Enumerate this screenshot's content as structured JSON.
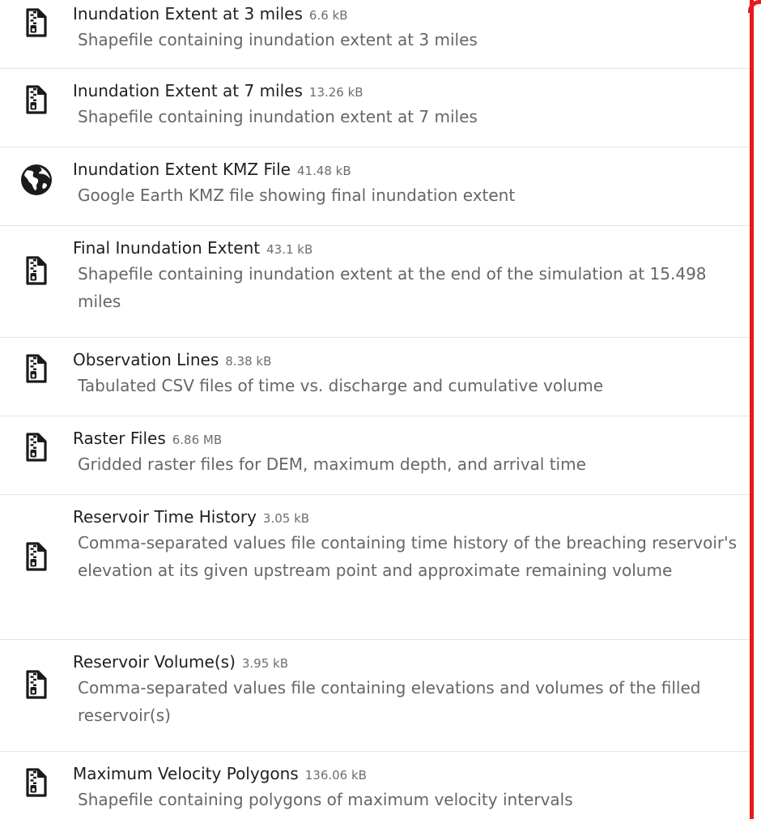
{
  "files": [
    {
      "title": "Inundation Extent at 3 miles",
      "size": "6.6 kB",
      "description": "Shapefile containing inundation extent at 3 miles",
      "icon": "zip-file-icon"
    },
    {
      "title": "Inundation Extent at 7 miles",
      "size": "13.26 kB",
      "description": "Shapefile containing inundation extent at 7 miles",
      "icon": "zip-file-icon"
    },
    {
      "title": "Inundation Extent KMZ File",
      "size": "41.48 kB",
      "description": "Google Earth KMZ file showing final inundation extent",
      "icon": "globe-icon"
    },
    {
      "title": "Final Inundation Extent",
      "size": "43.1 kB",
      "description": "Shapefile containing inundation extent at the end of the simulation at 15.498 miles",
      "icon": "zip-file-icon"
    },
    {
      "title": "Observation Lines",
      "size": "8.38 kB",
      "description": "Tabulated CSV files of time vs. discharge and cumulative volume",
      "icon": "zip-file-icon"
    },
    {
      "title": "Raster Files",
      "size": "6.86 MB",
      "description": "Gridded raster files for DEM, maximum depth, and arrival time",
      "icon": "zip-file-icon"
    },
    {
      "title": "Reservoir Time History",
      "size": "3.05 kB",
      "description": "Comma-separated values file containing time history of the breaching reservoir's elevation at its given upstream point and approximate remaining volume",
      "icon": "zip-file-icon"
    },
    {
      "title": "Reservoir Volume(s)",
      "size": "3.95 kB",
      "description": "Comma-separated values file containing elevations and volumes of the filled reservoir(s)",
      "icon": "zip-file-icon"
    },
    {
      "title": "Maximum Velocity Polygons",
      "size": "136.06 kB",
      "description": "Shapefile containing polygons of maximum velocity intervals",
      "icon": "zip-file-icon"
    }
  ],
  "colors": {
    "title": "#1f1f1f",
    "description": "#666666",
    "size": "#6e6e6e",
    "divider": "#e3e3e3",
    "highlight_border": "#e8191c"
  }
}
